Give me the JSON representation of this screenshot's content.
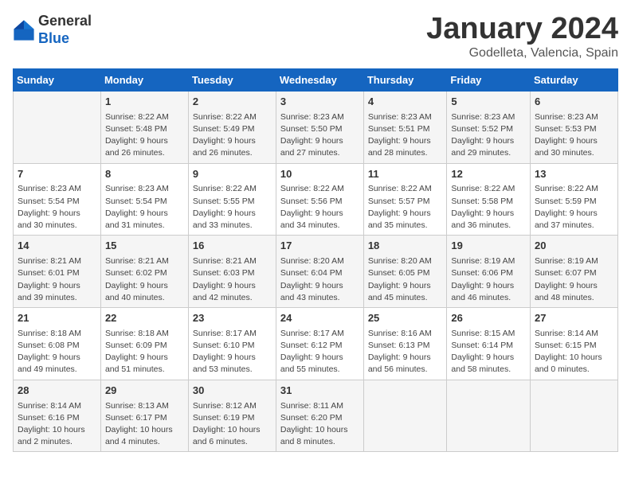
{
  "header": {
    "logo_general": "General",
    "logo_blue": "Blue",
    "title": "January 2024",
    "subtitle": "Godelleta, Valencia, Spain"
  },
  "days_of_week": [
    "Sunday",
    "Monday",
    "Tuesday",
    "Wednesday",
    "Thursday",
    "Friday",
    "Saturday"
  ],
  "weeks": [
    [
      {
        "day": "",
        "info": []
      },
      {
        "day": "1",
        "info": [
          "Sunrise: 8:22 AM",
          "Sunset: 5:48 PM",
          "Daylight: 9 hours",
          "and 26 minutes."
        ]
      },
      {
        "day": "2",
        "info": [
          "Sunrise: 8:22 AM",
          "Sunset: 5:49 PM",
          "Daylight: 9 hours",
          "and 26 minutes."
        ]
      },
      {
        "day": "3",
        "info": [
          "Sunrise: 8:23 AM",
          "Sunset: 5:50 PM",
          "Daylight: 9 hours",
          "and 27 minutes."
        ]
      },
      {
        "day": "4",
        "info": [
          "Sunrise: 8:23 AM",
          "Sunset: 5:51 PM",
          "Daylight: 9 hours",
          "and 28 minutes."
        ]
      },
      {
        "day": "5",
        "info": [
          "Sunrise: 8:23 AM",
          "Sunset: 5:52 PM",
          "Daylight: 9 hours",
          "and 29 minutes."
        ]
      },
      {
        "day": "6",
        "info": [
          "Sunrise: 8:23 AM",
          "Sunset: 5:53 PM",
          "Daylight: 9 hours",
          "and 30 minutes."
        ]
      }
    ],
    [
      {
        "day": "7",
        "info": [
          "Sunrise: 8:23 AM",
          "Sunset: 5:54 PM",
          "Daylight: 9 hours",
          "and 30 minutes."
        ]
      },
      {
        "day": "8",
        "info": [
          "Sunrise: 8:23 AM",
          "Sunset: 5:54 PM",
          "Daylight: 9 hours",
          "and 31 minutes."
        ]
      },
      {
        "day": "9",
        "info": [
          "Sunrise: 8:22 AM",
          "Sunset: 5:55 PM",
          "Daylight: 9 hours",
          "and 33 minutes."
        ]
      },
      {
        "day": "10",
        "info": [
          "Sunrise: 8:22 AM",
          "Sunset: 5:56 PM",
          "Daylight: 9 hours",
          "and 34 minutes."
        ]
      },
      {
        "day": "11",
        "info": [
          "Sunrise: 8:22 AM",
          "Sunset: 5:57 PM",
          "Daylight: 9 hours",
          "and 35 minutes."
        ]
      },
      {
        "day": "12",
        "info": [
          "Sunrise: 8:22 AM",
          "Sunset: 5:58 PM",
          "Daylight: 9 hours",
          "and 36 minutes."
        ]
      },
      {
        "day": "13",
        "info": [
          "Sunrise: 8:22 AM",
          "Sunset: 5:59 PM",
          "Daylight: 9 hours",
          "and 37 minutes."
        ]
      }
    ],
    [
      {
        "day": "14",
        "info": [
          "Sunrise: 8:21 AM",
          "Sunset: 6:01 PM",
          "Daylight: 9 hours",
          "and 39 minutes."
        ]
      },
      {
        "day": "15",
        "info": [
          "Sunrise: 8:21 AM",
          "Sunset: 6:02 PM",
          "Daylight: 9 hours",
          "and 40 minutes."
        ]
      },
      {
        "day": "16",
        "info": [
          "Sunrise: 8:21 AM",
          "Sunset: 6:03 PM",
          "Daylight: 9 hours",
          "and 42 minutes."
        ]
      },
      {
        "day": "17",
        "info": [
          "Sunrise: 8:20 AM",
          "Sunset: 6:04 PM",
          "Daylight: 9 hours",
          "and 43 minutes."
        ]
      },
      {
        "day": "18",
        "info": [
          "Sunrise: 8:20 AM",
          "Sunset: 6:05 PM",
          "Daylight: 9 hours",
          "and 45 minutes."
        ]
      },
      {
        "day": "19",
        "info": [
          "Sunrise: 8:19 AM",
          "Sunset: 6:06 PM",
          "Daylight: 9 hours",
          "and 46 minutes."
        ]
      },
      {
        "day": "20",
        "info": [
          "Sunrise: 8:19 AM",
          "Sunset: 6:07 PM",
          "Daylight: 9 hours",
          "and 48 minutes."
        ]
      }
    ],
    [
      {
        "day": "21",
        "info": [
          "Sunrise: 8:18 AM",
          "Sunset: 6:08 PM",
          "Daylight: 9 hours",
          "and 49 minutes."
        ]
      },
      {
        "day": "22",
        "info": [
          "Sunrise: 8:18 AM",
          "Sunset: 6:09 PM",
          "Daylight: 9 hours",
          "and 51 minutes."
        ]
      },
      {
        "day": "23",
        "info": [
          "Sunrise: 8:17 AM",
          "Sunset: 6:10 PM",
          "Daylight: 9 hours",
          "and 53 minutes."
        ]
      },
      {
        "day": "24",
        "info": [
          "Sunrise: 8:17 AM",
          "Sunset: 6:12 PM",
          "Daylight: 9 hours",
          "and 55 minutes."
        ]
      },
      {
        "day": "25",
        "info": [
          "Sunrise: 8:16 AM",
          "Sunset: 6:13 PM",
          "Daylight: 9 hours",
          "and 56 minutes."
        ]
      },
      {
        "day": "26",
        "info": [
          "Sunrise: 8:15 AM",
          "Sunset: 6:14 PM",
          "Daylight: 9 hours",
          "and 58 minutes."
        ]
      },
      {
        "day": "27",
        "info": [
          "Sunrise: 8:14 AM",
          "Sunset: 6:15 PM",
          "Daylight: 10 hours",
          "and 0 minutes."
        ]
      }
    ],
    [
      {
        "day": "28",
        "info": [
          "Sunrise: 8:14 AM",
          "Sunset: 6:16 PM",
          "Daylight: 10 hours",
          "and 2 minutes."
        ]
      },
      {
        "day": "29",
        "info": [
          "Sunrise: 8:13 AM",
          "Sunset: 6:17 PM",
          "Daylight: 10 hours",
          "and 4 minutes."
        ]
      },
      {
        "day": "30",
        "info": [
          "Sunrise: 8:12 AM",
          "Sunset: 6:19 PM",
          "Daylight: 10 hours",
          "and 6 minutes."
        ]
      },
      {
        "day": "31",
        "info": [
          "Sunrise: 8:11 AM",
          "Sunset: 6:20 PM",
          "Daylight: 10 hours",
          "and 8 minutes."
        ]
      },
      {
        "day": "",
        "info": []
      },
      {
        "day": "",
        "info": []
      },
      {
        "day": "",
        "info": []
      }
    ]
  ]
}
